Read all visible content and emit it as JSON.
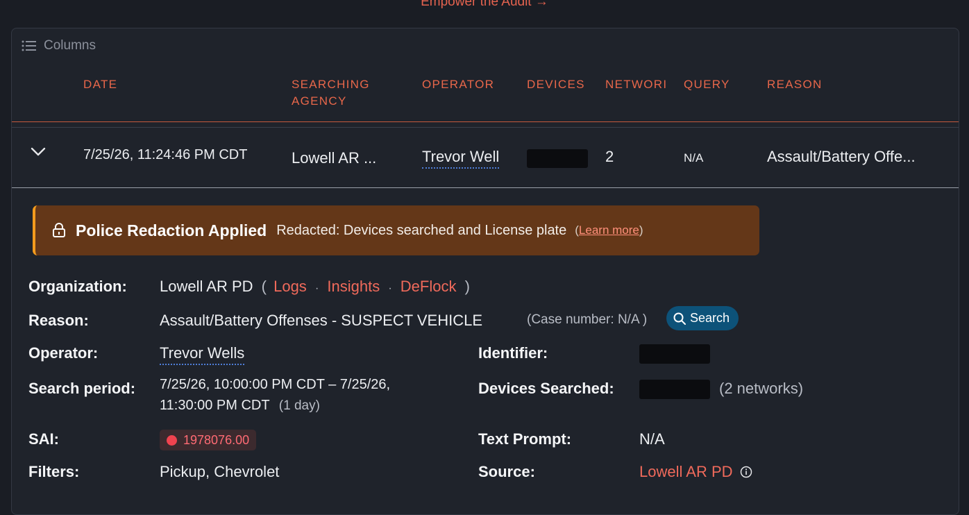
{
  "top_link": "Empower the Audit →",
  "toolbar": {
    "columns_label": "Columns"
  },
  "table": {
    "headers": {
      "date": "DATE",
      "agency_1": "SEARCHING",
      "agency_2": "AGENCY",
      "operator": "OPERATOR",
      "devices": "DEVICES",
      "networks": "NETWORI",
      "query": "QUERY",
      "reason": "REASON"
    },
    "row": {
      "date": "7/25/26, 11:24:46 PM CDT",
      "agency": "Lowell AR ...",
      "operator": "Trevor Well",
      "networks": "2",
      "query": "N/A",
      "reason": "Assault/Battery Offe..."
    }
  },
  "banner": {
    "title": "Police Redaction Applied",
    "text": "Redacted: Devices searched and License plate",
    "learn_open": "(",
    "learn_more": "Learn more",
    "learn_close": ")"
  },
  "details": {
    "organization_label": "Organization:",
    "organization_value": "Lowell AR PD",
    "org_paren_open": "(",
    "org_paren_close": ")",
    "org_links": {
      "logs": "Logs",
      "insights": "Insights",
      "deflock": "DeFlock",
      "sep": "·"
    },
    "reason_label": "Reason:",
    "reason_value": "Assault/Battery Offenses - SUSPECT VEHICLE",
    "case_number": "(Case number: N/A )",
    "search_button": "Search",
    "operator_label": "Operator:",
    "operator_value": "Trevor Wells",
    "search_period_label": "Search period:",
    "search_period_line1": "7/25/26, 10:00:00 PM CDT – 7/25/26,",
    "search_period_line2": "11:30:00 PM CDT",
    "search_period_duration": "(1 day)",
    "sai_label": "SAI:",
    "sai_value": "1978076.00",
    "filters_label": "Filters:",
    "filters_value": "Pickup, Chevrolet",
    "identifier_label": "Identifier:",
    "devices_searched_label": "Devices Searched:",
    "devices_networks": "(2 networks)",
    "text_prompt_label": "Text Prompt:",
    "text_prompt_value": "N/A",
    "source_label": "Source:",
    "source_value": "Lowell AR PD"
  },
  "colors": {
    "accent": "#e8674a",
    "link": "#f06a5b",
    "banner_bg": "#643718",
    "banner_border": "#f39b1e",
    "search_btn": "#0d5279",
    "sai_dot": "#f0434f"
  }
}
